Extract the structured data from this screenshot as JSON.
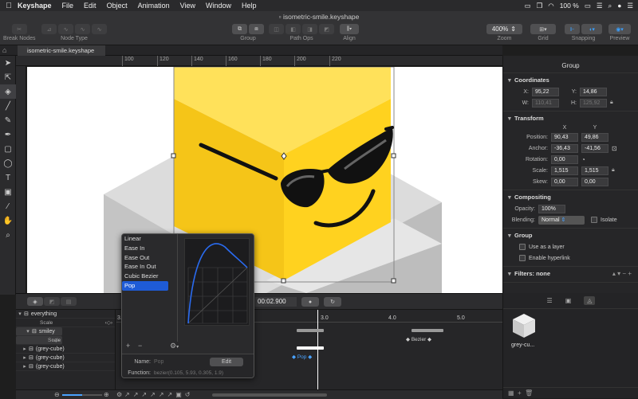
{
  "menubar": {
    "apple": "",
    "app": "Keyshape",
    "items": [
      "File",
      "Edit",
      "Object",
      "Animation",
      "View",
      "Window",
      "Help"
    ],
    "battery": "100 %",
    "clock": "◷"
  },
  "window": {
    "title": "isometric-smile.keyshape"
  },
  "toolbar": {
    "break_nodes": "Break Nodes",
    "node_type": "Node Type",
    "group": "Group",
    "path_ops": "Path Ops",
    "align": "Align",
    "zoom_value": "400%",
    "zoom": "Zoom",
    "grid": "Grid",
    "snapping": "Snapping",
    "preview": "Preview"
  },
  "tab": {
    "name": "isometric-smile.keyshape"
  },
  "ruler": {
    "marks": [
      "100",
      "120",
      "140",
      "160",
      "180",
      "200",
      "220"
    ]
  },
  "inspector": {
    "title": "Group",
    "coordinates": {
      "title": "Coordinates",
      "x_label": "X:",
      "x": "95,22",
      "y_label": "Y:",
      "y": "14,86",
      "w_label": "W:",
      "w": "110,41",
      "h_label": "H:",
      "h": "125,92"
    },
    "transform": {
      "title": "Transform",
      "col_x": "X",
      "col_y": "Y",
      "position_label": "Position:",
      "pos_x": "90,43",
      "pos_y": "49,86",
      "anchor_label": "Anchor:",
      "anc_x": "-36,43",
      "anc_y": "-41,56",
      "rotation_label": "Rotation:",
      "rotation": "0,00",
      "scale_label": "Scale:",
      "scale_x": "1,515",
      "scale_y": "1,515",
      "skew_label": "Skew:",
      "skew_x": "0,00",
      "skew_y": "0,00"
    },
    "compositing": {
      "title": "Compositing",
      "opacity_label": "Opacity:",
      "opacity": "100%",
      "blending_label": "Blending:",
      "blending": "Normal",
      "isolate": "Isolate"
    },
    "group": {
      "title": "Group",
      "use_as_layer": "Use as a layer",
      "enable_hyperlink": "Enable hyperlink"
    },
    "filters": {
      "title": "Filters: none"
    }
  },
  "animation": {
    "time": "00:02.900",
    "ticks": [
      "3.0",
      "4.0",
      "5.0"
    ],
    "layers": [
      {
        "name": "everything",
        "kind": "group"
      },
      {
        "name": "Scale",
        "kind": "prop"
      },
      {
        "name": "smiley",
        "kind": "group"
      },
      {
        "name": "Scale",
        "kind": "prop"
      },
      {
        "name": "(grey-cube)",
        "kind": "group"
      },
      {
        "name": "(grey-cube)",
        "kind": "group"
      },
      {
        "name": "(grey-cube)",
        "kind": "group"
      }
    ],
    "bezier_label": "Bezier",
    "pop_label": "Pop"
  },
  "easing_popup": {
    "items": [
      "Linear",
      "Ease In",
      "Ease Out",
      "Ease In Out",
      "Cubic Bezier",
      "Pop"
    ],
    "selected": "Pop",
    "add": "+",
    "remove": "−",
    "gear": "⚙",
    "name_label": "Name:",
    "name_placeholder": "Pop",
    "edit": "Edit",
    "function_label": "Function:",
    "function": "bezier(0.105, 5.93, 0.305, 1.9)"
  },
  "library": {
    "item_name": "grey-cu..."
  }
}
